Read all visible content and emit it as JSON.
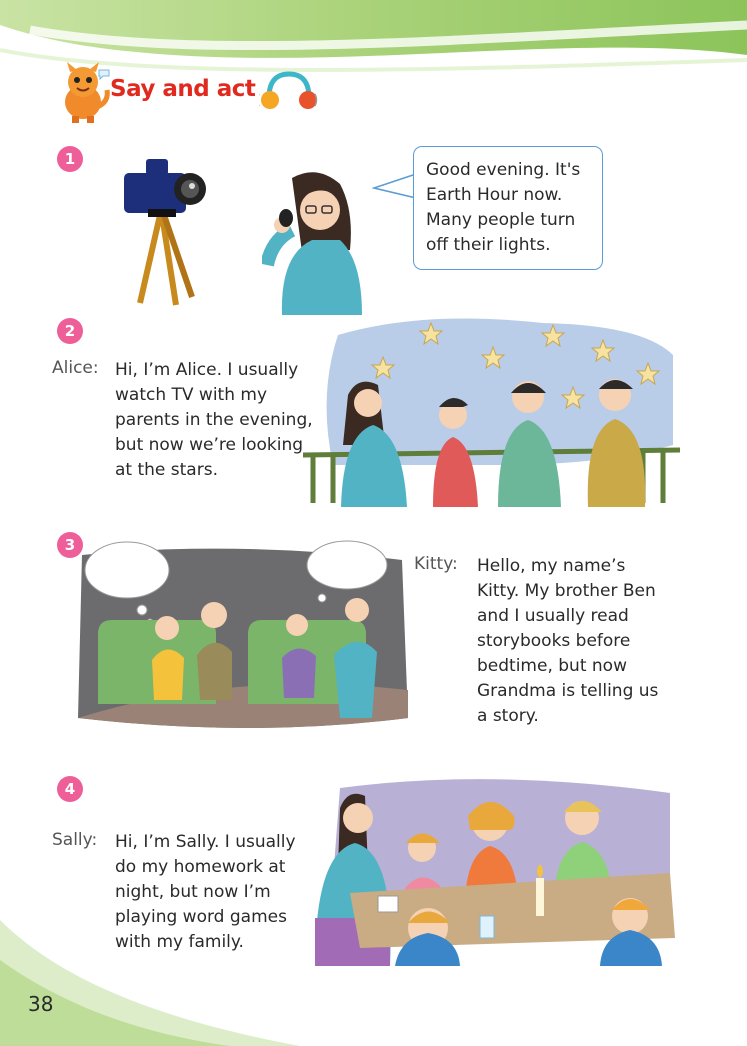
{
  "header": {
    "title": "Say and act"
  },
  "sections": [
    {
      "number": "1",
      "speech": [
        "Good evening. It's",
        "Earth Hour now.",
        "Many people turn",
        "off their lights."
      ]
    },
    {
      "number": "2",
      "speaker": "Alice:",
      "speech": [
        "Hi, I’m Alice. I usually",
        "watch TV with my",
        "parents in the evening,",
        "but now we’re looking",
        "at the stars."
      ]
    },
    {
      "number": "3",
      "speaker": "Kitty:",
      "speech": [
        "Hello, my name’s",
        "Kitty. My brother Ben",
        "and I usually read",
        "storybooks before",
        "bedtime, but now",
        "Grandma is telling us",
        "a story."
      ]
    },
    {
      "number": "4",
      "speaker": "Sally:",
      "speech": [
        "Hi, I’m Sally. I usually",
        "do my homework at",
        "night, but now I’m",
        "playing word games",
        "with my family."
      ]
    }
  ],
  "page_number": "38",
  "colors": {
    "accent_red": "#e02a1f",
    "number_pink": "#ee5f9a",
    "bubble_blue": "#5b9bd5",
    "swoosh_green": "#9fce6a"
  },
  "icons": [
    "cartoon-cat-mascot-icon",
    "headphones-icon",
    "video-camera-icon"
  ]
}
